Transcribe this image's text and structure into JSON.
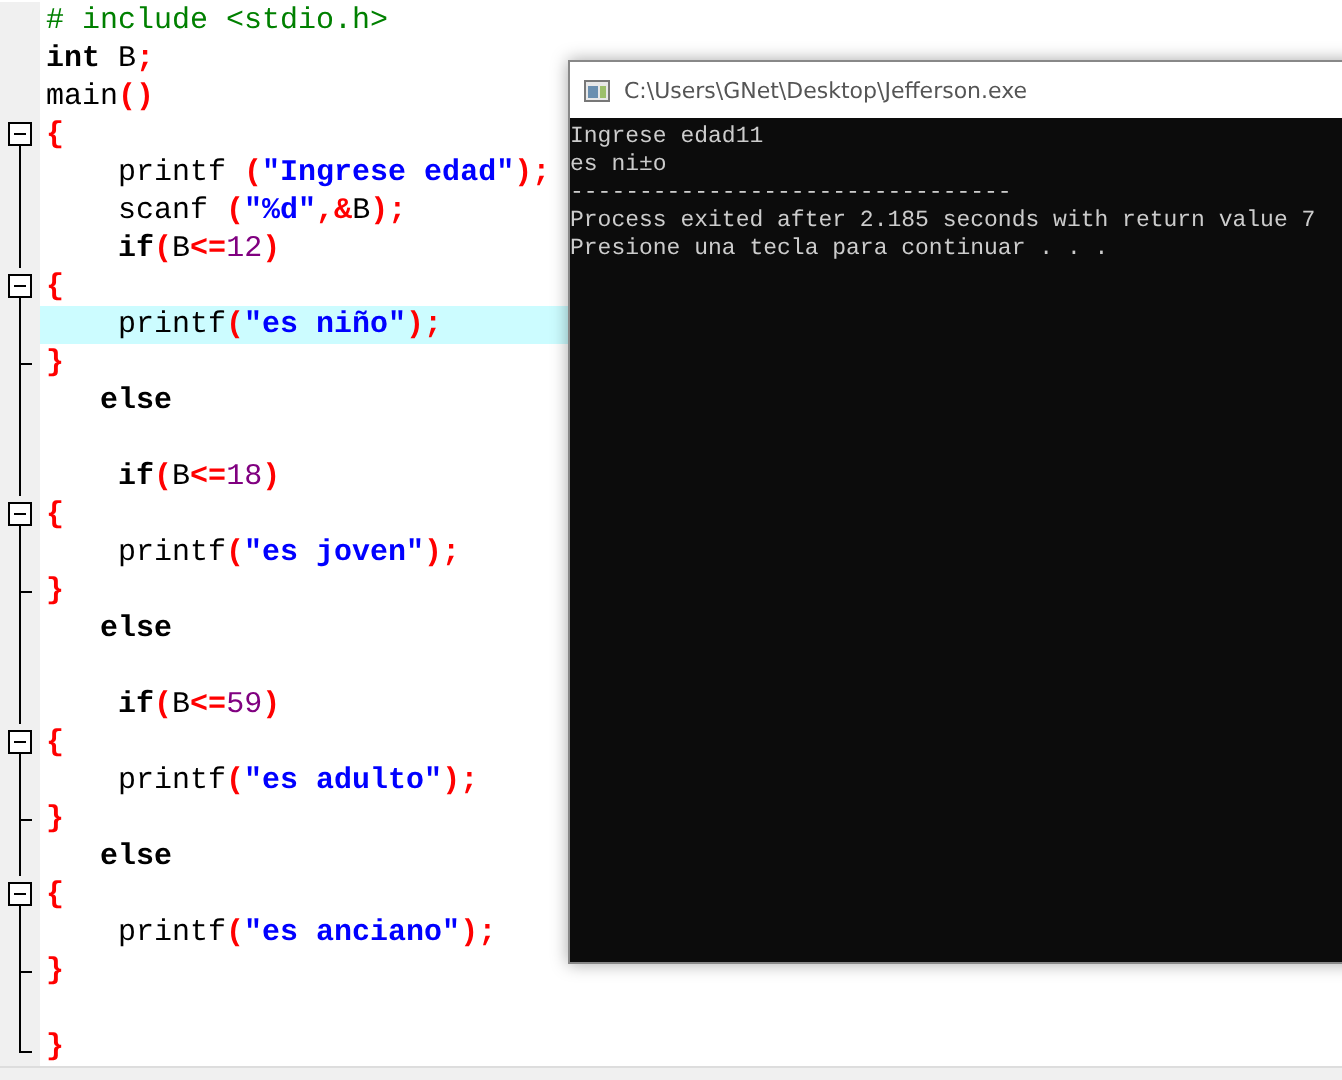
{
  "editor": {
    "lines": [
      {
        "kind": "none",
        "highlighted": false,
        "tokens": [
          {
            "kind": "preprocessor",
            "text": "# include <stdio.h>"
          }
        ]
      },
      {
        "kind": "none",
        "highlighted": false,
        "tokens": [
          {
            "kind": "keyword",
            "text": "int"
          },
          {
            "kind": "plain",
            "text": " B"
          },
          {
            "kind": "symbol",
            "text": ";"
          }
        ]
      },
      {
        "kind": "none",
        "highlighted": false,
        "tokens": [
          {
            "kind": "plain",
            "text": "main"
          },
          {
            "kind": "symbol",
            "text": "()"
          }
        ]
      },
      {
        "kind": "start",
        "highlighted": false,
        "tokens": [
          {
            "kind": "symbol",
            "text": "{"
          }
        ]
      },
      {
        "kind": "line",
        "highlighted": false,
        "tokens": [
          {
            "kind": "plain",
            "text": "    printf "
          },
          {
            "kind": "symbol",
            "text": "("
          },
          {
            "kind": "string",
            "text": "\"Ingrese edad\""
          },
          {
            "kind": "symbol",
            "text": ");"
          }
        ]
      },
      {
        "kind": "line",
        "highlighted": false,
        "tokens": [
          {
            "kind": "plain",
            "text": "    scanf "
          },
          {
            "kind": "symbol",
            "text": "("
          },
          {
            "kind": "string",
            "text": "\"%d\""
          },
          {
            "kind": "symbol",
            "text": ",&"
          },
          {
            "kind": "plain",
            "text": "B"
          },
          {
            "kind": "symbol",
            "text": ");"
          }
        ]
      },
      {
        "kind": "line",
        "highlighted": false,
        "tokens": [
          {
            "kind": "keyword",
            "text": "    if"
          },
          {
            "kind": "symbol",
            "text": "("
          },
          {
            "kind": "plain",
            "text": "B"
          },
          {
            "kind": "symbol",
            "text": "<="
          },
          {
            "kind": "number",
            "text": "12"
          },
          {
            "kind": "symbol",
            "text": ")"
          }
        ]
      },
      {
        "kind": "start",
        "highlighted": false,
        "tokens": [
          {
            "kind": "symbol",
            "text": "{"
          }
        ]
      },
      {
        "kind": "line",
        "highlighted": true,
        "tokens": [
          {
            "kind": "plain",
            "text": "    printf"
          },
          {
            "kind": "symbol",
            "text": "("
          },
          {
            "kind": "string",
            "text": "\"es niño\""
          },
          {
            "kind": "symbol",
            "text": ");"
          }
        ]
      },
      {
        "kind": "end",
        "highlighted": false,
        "tokens": [
          {
            "kind": "symbol",
            "text": "}"
          }
        ]
      },
      {
        "kind": "line",
        "highlighted": false,
        "tokens": [
          {
            "kind": "keyword",
            "text": "   else"
          }
        ]
      },
      {
        "kind": "line",
        "highlighted": false
      },
      {
        "kind": "line",
        "highlighted": false,
        "tokens": [
          {
            "kind": "keyword",
            "text": "    if"
          },
          {
            "kind": "symbol",
            "text": "("
          },
          {
            "kind": "plain",
            "text": "B"
          },
          {
            "kind": "symbol",
            "text": "<="
          },
          {
            "kind": "number",
            "text": "18"
          },
          {
            "kind": "symbol",
            "text": ")"
          }
        ]
      },
      {
        "kind": "start",
        "highlighted": false,
        "tokens": [
          {
            "kind": "symbol",
            "text": "{"
          }
        ]
      },
      {
        "kind": "line",
        "highlighted": false,
        "tokens": [
          {
            "kind": "plain",
            "text": "    printf"
          },
          {
            "kind": "symbol",
            "text": "("
          },
          {
            "kind": "string",
            "text": "\"es joven\""
          },
          {
            "kind": "symbol",
            "text": ");"
          }
        ]
      },
      {
        "kind": "end",
        "highlighted": false,
        "tokens": [
          {
            "kind": "symbol",
            "text": "}"
          }
        ]
      },
      {
        "kind": "line",
        "highlighted": false,
        "tokens": [
          {
            "kind": "keyword",
            "text": "   else"
          }
        ]
      },
      {
        "kind": "line",
        "highlighted": false
      },
      {
        "kind": "line",
        "highlighted": false,
        "tokens": [
          {
            "kind": "keyword",
            "text": "    if"
          },
          {
            "kind": "symbol",
            "text": "("
          },
          {
            "kind": "plain",
            "text": "B"
          },
          {
            "kind": "symbol",
            "text": "<="
          },
          {
            "kind": "number",
            "text": "59"
          },
          {
            "kind": "symbol",
            "text": ")"
          }
        ]
      },
      {
        "kind": "start",
        "highlighted": false,
        "tokens": [
          {
            "kind": "symbol",
            "text": "{"
          }
        ]
      },
      {
        "kind": "line",
        "highlighted": false,
        "tokens": [
          {
            "kind": "plain",
            "text": "    printf"
          },
          {
            "kind": "symbol",
            "text": "("
          },
          {
            "kind": "string",
            "text": "\"es adulto\""
          },
          {
            "kind": "symbol",
            "text": ");"
          }
        ]
      },
      {
        "kind": "end",
        "highlighted": false,
        "tokens": [
          {
            "kind": "symbol",
            "text": "}"
          }
        ]
      },
      {
        "kind": "line",
        "highlighted": false,
        "tokens": [
          {
            "kind": "keyword",
            "text": "   else"
          }
        ]
      },
      {
        "kind": "start",
        "highlighted": false,
        "tokens": [
          {
            "kind": "symbol",
            "text": "{"
          }
        ]
      },
      {
        "kind": "line",
        "highlighted": false,
        "tokens": [
          {
            "kind": "plain",
            "text": "    printf"
          },
          {
            "kind": "symbol",
            "text": "("
          },
          {
            "kind": "string",
            "text": "\"es anciano\""
          },
          {
            "kind": "symbol",
            "text": ");"
          }
        ]
      },
      {
        "kind": "end",
        "highlighted": false,
        "tokens": [
          {
            "kind": "symbol",
            "text": "}"
          }
        ]
      },
      {
        "kind": "line",
        "highlighted": false
      },
      {
        "kind": "last",
        "highlighted": false,
        "tokens": [
          {
            "kind": "symbol",
            "text": "}"
          }
        ]
      }
    ]
  },
  "console": {
    "title": "C:\\Users\\GNet\\Desktop\\Jefferson.exe",
    "lines": [
      "Ingrese edad11",
      "es ni±o",
      "--------------------------------",
      "Process exited after 2.185 seconds with return value 7",
      "Presione una tecla para continuar . . ."
    ]
  }
}
